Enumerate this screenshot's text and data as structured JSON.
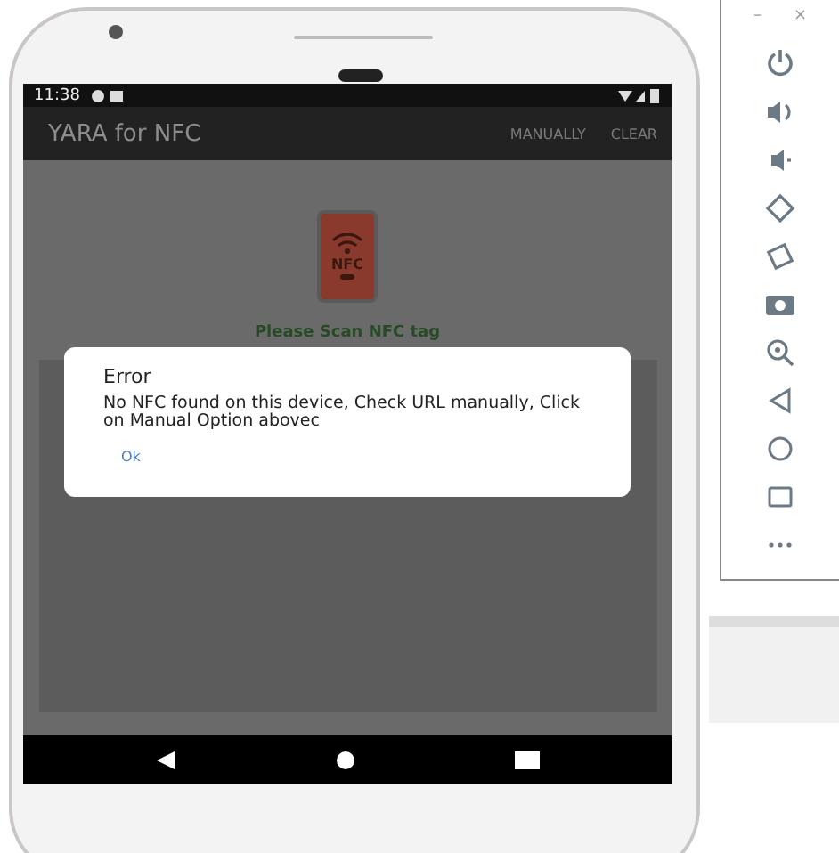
{
  "status_bar": {
    "time": "11:38"
  },
  "app_bar": {
    "title": "YARA for NFC",
    "actions": [
      "MANUALLY",
      "CLEAR"
    ]
  },
  "content": {
    "icon_label": "NFC",
    "message": "Please Scan NFC tag"
  },
  "dialog": {
    "title": "Error",
    "message": "No NFC found on this device, Check URL manually, Click on Manual Option abovec",
    "buttons": [
      "Ok"
    ]
  },
  "emulator_toolbar": {
    "window_controls": [
      "–",
      "×"
    ]
  }
}
